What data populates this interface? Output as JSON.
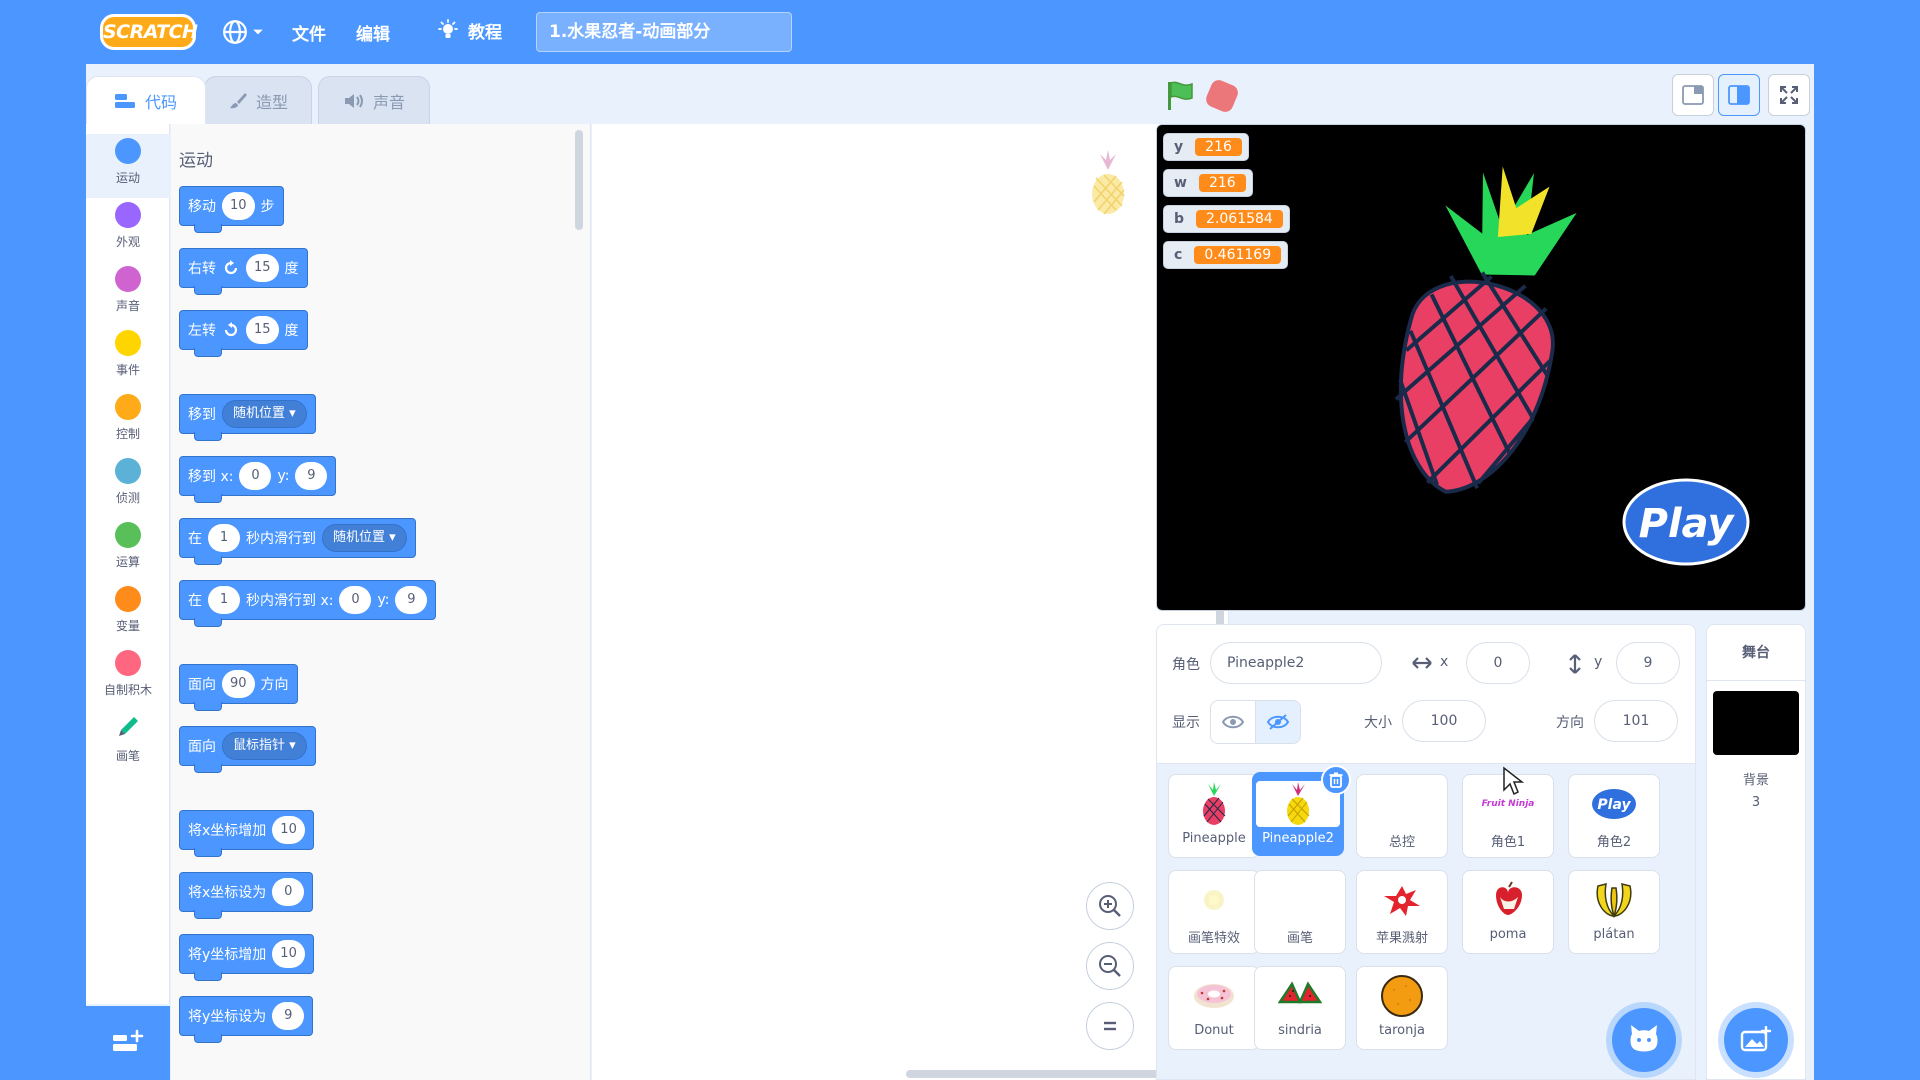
{
  "menubar": {
    "logo": "SCRATCH",
    "file": "文件",
    "edit": "编辑",
    "tutorials": "教程",
    "project_title": "1.水果忍者-动画部分"
  },
  "tabs": [
    {
      "label": "代码"
    },
    {
      "label": "造型"
    },
    {
      "label": "声音"
    }
  ],
  "categories": [
    {
      "label": "运动",
      "color": "#4c97ff"
    },
    {
      "label": "外观",
      "color": "#9966ff"
    },
    {
      "label": "声音",
      "color": "#cf63cf"
    },
    {
      "label": "事件",
      "color": "#ffd500"
    },
    {
      "label": "控制",
      "color": "#ffab19"
    },
    {
      "label": "侦测",
      "color": "#5cb1d6"
    },
    {
      "label": "运算",
      "color": "#59c059"
    },
    {
      "label": "变量",
      "color": "#ff8c1a"
    },
    {
      "label": "自制积木",
      "color": "#ff6680"
    },
    {
      "label": "画笔",
      "color": "#0fbd8c"
    }
  ],
  "palette": {
    "title": "运动",
    "move": {
      "label": "移动",
      "value": "10",
      "suffix": "步"
    },
    "turn_right": {
      "label": "右转",
      "value": "15",
      "suffix": "度"
    },
    "turn_left": {
      "label": "左转",
      "value": "15",
      "suffix": "度"
    },
    "goto": {
      "label": "移到",
      "option": "随机位置"
    },
    "goto_xy": {
      "label_x": "移到 x:",
      "x": "0",
      "label_y": "y:",
      "y": "9"
    },
    "glide": {
      "prefix": "在",
      "secs": "1",
      "label": "秒内滑行到",
      "option": "随机位置"
    },
    "glide_xy": {
      "prefix": "在",
      "secs": "1",
      "label_x": "秒内滑行到 x:",
      "x": "0",
      "label_y": "y:",
      "y": "9"
    },
    "point_dir": {
      "label": "面向",
      "value": "90",
      "suffix": "方向"
    },
    "point_towards": {
      "label": "面向",
      "option": "鼠标指针"
    },
    "change_x": {
      "label": "将x坐标增加",
      "value": "10"
    },
    "set_x": {
      "label": "将x坐标设为",
      "value": "0"
    },
    "change_y": {
      "label": "将y坐标增加",
      "value": "10"
    },
    "set_y": {
      "label": "将y坐标设为",
      "value": "9"
    }
  },
  "monitors": [
    {
      "name": "y",
      "value": "216"
    },
    {
      "name": "w",
      "value": "216"
    },
    {
      "name": "b",
      "value": "2.061584"
    },
    {
      "name": "c",
      "value": "0.461169"
    }
  ],
  "stage": {
    "play_text": "Play"
  },
  "sprite_info": {
    "sprite_label": "角色",
    "sprite_name": "Pineapple2",
    "x_label": "x",
    "x": "0",
    "y_label": "y",
    "y": "9",
    "show_label": "显示",
    "size_label": "大小",
    "size": "100",
    "direction_label": "方向",
    "direction": "101"
  },
  "sprites": [
    {
      "name": "Pineapple"
    },
    {
      "name": "Pineapple2"
    },
    {
      "name": "总控"
    },
    {
      "name": "角色1"
    },
    {
      "name": "角色2"
    },
    {
      "name": "画笔特效"
    },
    {
      "name": "画笔"
    },
    {
      "name": "苹果溅射"
    },
    {
      "name": "poma"
    },
    {
      "name": "plátan"
    },
    {
      "name": "Donut"
    },
    {
      "name": "sindria"
    },
    {
      "name": "taronja"
    }
  ],
  "sprite_thumbs": {
    "fruit_ninja_text": "Fruit Ninja",
    "play_text": "Play"
  },
  "stage_panel": {
    "title": "舞台",
    "backdrop_label": "背景",
    "backdrop_count": "3"
  }
}
